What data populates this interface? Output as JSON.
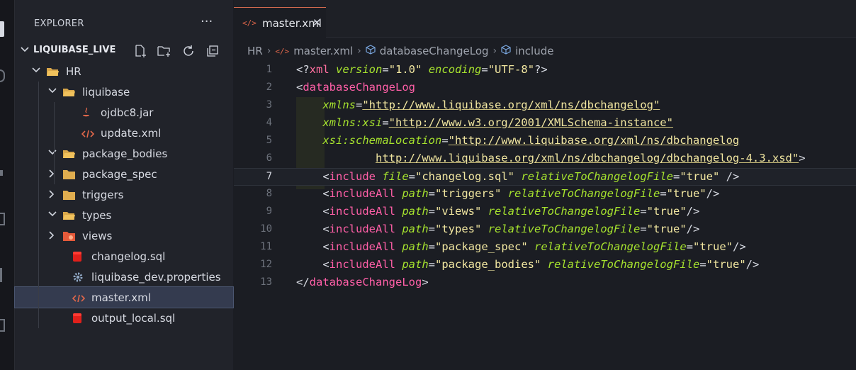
{
  "explorer": {
    "title": "EXPLORER",
    "more": "···",
    "section": "LIQUIBASE_LIVE"
  },
  "tree": [
    {
      "label": "HR",
      "kind": "folder-open",
      "depth": 0,
      "chevron": "down"
    },
    {
      "label": "liquibase",
      "kind": "folder-open",
      "depth": 1,
      "chevron": "down"
    },
    {
      "label": "ojdbc8.jar",
      "kind": "java-file",
      "depth": 2,
      "chevron": ""
    },
    {
      "label": "update.xml",
      "kind": "xml-file",
      "depth": 2,
      "chevron": ""
    },
    {
      "label": "package_bodies",
      "kind": "folder-open",
      "depth": 1,
      "chevron": "down"
    },
    {
      "label": "package_spec",
      "kind": "folder",
      "depth": 1,
      "chevron": "right"
    },
    {
      "label": "triggers",
      "kind": "folder",
      "depth": 1,
      "chevron": "right"
    },
    {
      "label": "types",
      "kind": "folder-open",
      "depth": 1,
      "chevron": "down"
    },
    {
      "label": "views",
      "kind": "folder-special",
      "depth": 1,
      "chevron": "right"
    },
    {
      "label": "changelog.sql",
      "kind": "sql-file",
      "depth": 1,
      "chevron": ""
    },
    {
      "label": "liquibase_dev.properties",
      "kind": "gear-file",
      "depth": 1,
      "chevron": ""
    },
    {
      "label": "master.xml",
      "kind": "xml-file",
      "depth": 1,
      "chevron": "",
      "selected": true
    },
    {
      "label": "output_local.sql",
      "kind": "sql-file",
      "depth": 1,
      "chevron": ""
    }
  ],
  "tab": {
    "label": "master.xml",
    "close": "✕"
  },
  "breadcrumb": {
    "root": "HR",
    "file": "master.xml",
    "node1": "databaseChangeLog",
    "node2": "include"
  },
  "code_lines": [
    {
      "n": "1",
      "tokens": [
        [
          "br",
          "<?"
        ],
        [
          "pi",
          "xml"
        ],
        [
          "br",
          " "
        ],
        [
          "attr",
          "version"
        ],
        [
          "br",
          "="
        ],
        [
          "str",
          "\"1.0\""
        ],
        [
          "br",
          " "
        ],
        [
          "attr",
          "encoding"
        ],
        [
          "br",
          "="
        ],
        [
          "str",
          "\"UTF-8\""
        ],
        [
          "br",
          "?>"
        ]
      ]
    },
    {
      "n": "2",
      "tokens": [
        [
          "br",
          "<"
        ],
        [
          "tag",
          "databaseChangeLog"
        ]
      ]
    },
    {
      "n": "3",
      "tokens": [
        [
          "br",
          "    "
        ],
        [
          "attr",
          "xmlns"
        ],
        [
          "br",
          "="
        ],
        [
          "url",
          "\"http://www.liquibase.org/xml/ns/dbchangelog\""
        ]
      ]
    },
    {
      "n": "4",
      "tokens": [
        [
          "br",
          "    "
        ],
        [
          "attr",
          "xmlns:xsi"
        ],
        [
          "br",
          "="
        ],
        [
          "url",
          "\"http://www.w3.org/2001/XMLSchema-instance\""
        ]
      ]
    },
    {
      "n": "5",
      "tokens": [
        [
          "br",
          "    "
        ],
        [
          "attr",
          "xsi:schemaLocation"
        ],
        [
          "br",
          "="
        ],
        [
          "url",
          "\"http://www.liquibase.org/xml/ns/dbchangelog"
        ]
      ]
    },
    {
      "n": "6",
      "tokens": [
        [
          "br",
          "            "
        ],
        [
          "url",
          "http://www.liquibase.org/xml/ns/dbchangelog/dbchangelog-4.3.xsd\""
        ],
        [
          "br",
          ">"
        ]
      ]
    },
    {
      "n": "7",
      "active": true,
      "tokens": [
        [
          "br",
          "    <"
        ],
        [
          "tag",
          "include"
        ],
        [
          "br",
          " "
        ],
        [
          "attr",
          "file"
        ],
        [
          "br",
          "="
        ],
        [
          "str",
          "\"changelog.sql\""
        ],
        [
          "br",
          " "
        ],
        [
          "attr",
          "relativeToChangelogFile"
        ],
        [
          "br",
          "="
        ],
        [
          "str",
          "\"true\""
        ],
        [
          "br",
          " />"
        ]
      ]
    },
    {
      "n": "8",
      "tokens": [
        [
          "br",
          "    <"
        ],
        [
          "tag",
          "includeAll"
        ],
        [
          "br",
          " "
        ],
        [
          "attr",
          "path"
        ],
        [
          "br",
          "="
        ],
        [
          "str",
          "\"triggers\""
        ],
        [
          "br",
          " "
        ],
        [
          "attr",
          "relativeToChangelogFile"
        ],
        [
          "br",
          "="
        ],
        [
          "str",
          "\"true\""
        ],
        [
          "br",
          "/>"
        ]
      ]
    },
    {
      "n": "9",
      "tokens": [
        [
          "br",
          "    <"
        ],
        [
          "tag",
          "includeAll"
        ],
        [
          "br",
          " "
        ],
        [
          "attr",
          "path"
        ],
        [
          "br",
          "="
        ],
        [
          "str",
          "\"views\""
        ],
        [
          "br",
          " "
        ],
        [
          "attr",
          "relativeToChangelogFile"
        ],
        [
          "br",
          "="
        ],
        [
          "str",
          "\"true\""
        ],
        [
          "br",
          "/>"
        ]
      ]
    },
    {
      "n": "10",
      "tokens": [
        [
          "br",
          "    <"
        ],
        [
          "tag",
          "includeAll"
        ],
        [
          "br",
          " "
        ],
        [
          "attr",
          "path"
        ],
        [
          "br",
          "="
        ],
        [
          "str",
          "\"types\""
        ],
        [
          "br",
          " "
        ],
        [
          "attr",
          "relativeToChangelogFile"
        ],
        [
          "br",
          "="
        ],
        [
          "str",
          "\"true\""
        ],
        [
          "br",
          "/>"
        ]
      ]
    },
    {
      "n": "11",
      "tokens": [
        [
          "br",
          "    <"
        ],
        [
          "tag",
          "includeAll"
        ],
        [
          "br",
          " "
        ],
        [
          "attr",
          "path"
        ],
        [
          "br",
          "="
        ],
        [
          "str",
          "\"package_spec\""
        ],
        [
          "br",
          " "
        ],
        [
          "attr",
          "relativeToChangelogFile"
        ],
        [
          "br",
          "="
        ],
        [
          "str",
          "\"true\""
        ],
        [
          "br",
          "/>"
        ]
      ]
    },
    {
      "n": "12",
      "tokens": [
        [
          "br",
          "    <"
        ],
        [
          "tag",
          "includeAll"
        ],
        [
          "br",
          " "
        ],
        [
          "attr",
          "path"
        ],
        [
          "br",
          "="
        ],
        [
          "str",
          "\"package_bodies\""
        ],
        [
          "br",
          " "
        ],
        [
          "attr",
          "relativeToChangelogFile"
        ],
        [
          "br",
          "="
        ],
        [
          "str",
          "\"true\""
        ],
        [
          "br",
          "/>"
        ]
      ]
    },
    {
      "n": "13",
      "tokens": [
        [
          "br",
          "</"
        ],
        [
          "tag",
          "databaseChangeLog"
        ],
        [
          "br",
          ">"
        ]
      ]
    }
  ]
}
